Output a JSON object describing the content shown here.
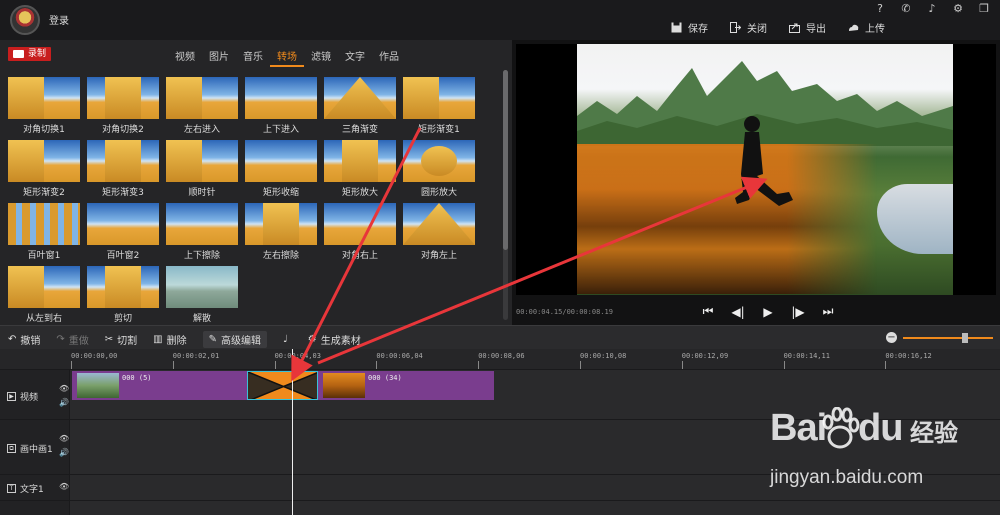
{
  "topbar": {
    "login": "登录",
    "actions": [
      {
        "label": "保存",
        "icon": "save-icon"
      },
      {
        "label": "关闭",
        "icon": "close-project-icon"
      },
      {
        "label": "导出",
        "icon": "export-icon"
      },
      {
        "label": "上传",
        "icon": "upload-icon"
      }
    ],
    "sys": [
      "?",
      "☎",
      "🔔",
      "⚙",
      "❐"
    ]
  },
  "library": {
    "record": "录制",
    "tabs": [
      {
        "label": "视频",
        "active": false
      },
      {
        "label": "图片",
        "active": false
      },
      {
        "label": "音乐",
        "active": false
      },
      {
        "label": "转场",
        "active": true
      },
      {
        "label": "滤镜",
        "active": false
      },
      {
        "label": "文字",
        "active": false
      },
      {
        "label": "作品",
        "active": false
      }
    ],
    "transitions": [
      {
        "label": "对角切换1",
        "style": "left"
      },
      {
        "label": "对角切换2",
        "style": "mid"
      },
      {
        "label": "左右进入",
        "style": "left"
      },
      {
        "label": "上下进入",
        "style": "plain"
      },
      {
        "label": "三角渐变",
        "style": "tri"
      },
      {
        "label": "矩形渐变1",
        "style": "left"
      },
      {
        "label": "矩形渐变2",
        "style": "left"
      },
      {
        "label": "矩形渐变3",
        "style": "mid"
      },
      {
        "label": "顺时针",
        "style": "left"
      },
      {
        "label": "矩形收缩",
        "style": "plain"
      },
      {
        "label": "矩形放大",
        "style": "mid"
      },
      {
        "label": "圆形放大",
        "style": "circle"
      },
      {
        "label": "百叶窗1",
        "style": "stripes"
      },
      {
        "label": "百叶窗2",
        "style": "plain"
      },
      {
        "label": "上下擦除",
        "style": "plain"
      },
      {
        "label": "左右擦除",
        "style": "mid"
      },
      {
        "label": "对角右上",
        "style": "plain"
      },
      {
        "label": "对角左上",
        "style": "tri"
      },
      {
        "label": "从左到右",
        "style": "left"
      },
      {
        "label": "剪切",
        "style": "mid"
      },
      {
        "label": "解散",
        "style": "sea"
      }
    ]
  },
  "preview": {
    "time": "00:00:04.15/00:00:08.19",
    "controls": [
      "skip-start-icon",
      "step-back-icon",
      "play-icon",
      "step-forward-icon",
      "skip-end-icon"
    ]
  },
  "editbar": {
    "tools": [
      {
        "label": "撤销",
        "icon": "↶",
        "dim": false
      },
      {
        "label": "重做",
        "icon": "↷",
        "dim": true
      },
      {
        "label": "切割",
        "icon": "✂",
        "dim": false
      },
      {
        "label": "删除",
        "icon": "🗑",
        "dim": false
      },
      {
        "label": "高级编辑",
        "icon": "✎",
        "dim": false
      },
      {
        "label": "",
        "icon": "🎙",
        "dim": false
      },
      {
        "label": "生成素材",
        "icon": "⚙",
        "dim": false
      }
    ],
    "zoom_level": 0.65
  },
  "timeline": {
    "ticks": [
      "00:00:00,00",
      "00:00:02,01",
      "00:00:04,03",
      "00:00:06,04",
      "00:00:08,06",
      "00:00:10,08",
      "00:00:12,09",
      "00:00:14,11",
      "00:00:16,12"
    ],
    "tracks": [
      {
        "name": "视频",
        "icon": "▶"
      },
      {
        "name": "画中画1",
        "icon": "⧉"
      },
      {
        "name": "文字1",
        "icon": "T"
      }
    ],
    "clips": [
      {
        "label": "000 (5)"
      },
      {
        "label": "000 (34)"
      }
    ]
  },
  "watermark": {
    "brand": "Bai",
    "brand2": "du",
    "jingyan": "经验",
    "url": "jingyan.baidu.com"
  },
  "colors": {
    "accent": "#f08a1c",
    "clip": "#7a3d8e",
    "record": "#c81e1e",
    "arrow": "#e8363a"
  }
}
